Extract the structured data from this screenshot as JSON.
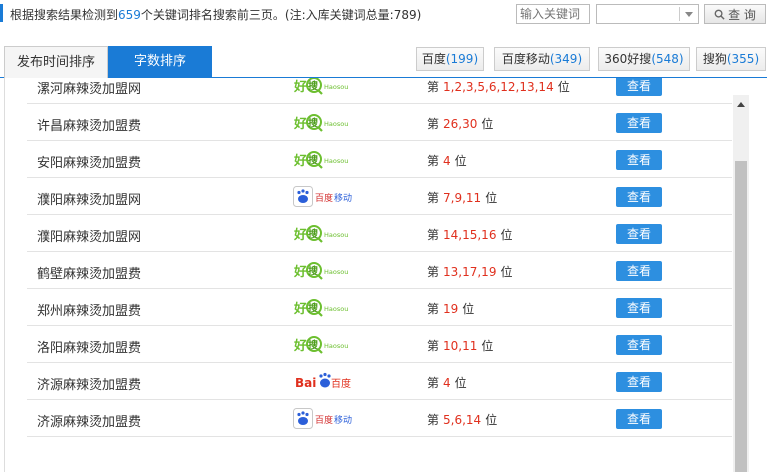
{
  "header": {
    "summary_prefix": "根据搜索结果检测到",
    "keyword_count": "659",
    "summary_suffix": "个关键词排名搜索前三页。(注:入库关键词总量:789)",
    "search_placeholder": "输入关键词",
    "select_value": "",
    "query_label": "查 询"
  },
  "tabs": [
    {
      "label": "发布时间排序",
      "active": false
    },
    {
      "label": "字数排序",
      "active": true
    }
  ],
  "engines": [
    {
      "name": "百度",
      "count": "(199)"
    },
    {
      "name": "百度移动",
      "count": "(349)"
    },
    {
      "name": "360好搜",
      "count": "(548)"
    },
    {
      "name": "搜狗",
      "count": "(355)"
    }
  ],
  "logos": {
    "haosou": {
      "main": "好搜",
      "sub": "Haosou"
    },
    "baidu_mobile": {
      "main": "百度移动"
    },
    "baidu": {
      "bai": "Bai",
      "du": "百度"
    }
  },
  "rank_prefix": "第",
  "rank_suffix": "位",
  "rows": [
    {
      "keyword": "漯河麻辣烫加盟网",
      "engine": "haosou",
      "positions": "1,2,3,5,6,12,13,14",
      "button": "查看"
    },
    {
      "keyword": "许昌麻辣烫加盟费",
      "engine": "haosou",
      "positions": "26,30",
      "button": "查看"
    },
    {
      "keyword": "安阳麻辣烫加盟费",
      "engine": "haosou",
      "positions": "4",
      "button": "查看"
    },
    {
      "keyword": "濮阳麻辣烫加盟网",
      "engine": "baidu_mobile",
      "positions": "7,9,11",
      "button": "查看"
    },
    {
      "keyword": "濮阳麻辣烫加盟网",
      "engine": "haosou",
      "positions": "14,15,16",
      "button": "查看"
    },
    {
      "keyword": "鹤壁麻辣烫加盟费",
      "engine": "haosou",
      "positions": "13,17,19",
      "button": "查看"
    },
    {
      "keyword": "郑州麻辣烫加盟费",
      "engine": "haosou",
      "positions": "19",
      "button": "查看"
    },
    {
      "keyword": "洛阳麻辣烫加盟费",
      "engine": "haosou",
      "positions": "10,11",
      "button": "查看"
    },
    {
      "keyword": "济源麻辣烫加盟费",
      "engine": "baidu",
      "positions": "4",
      "button": "查看"
    },
    {
      "keyword": "济源麻辣烫加盟费",
      "engine": "baidu_mobile",
      "positions": "5,6,14",
      "button": "查看"
    }
  ],
  "colors": {
    "accent": "#1a7bd6",
    "rank_red": "#e0301e",
    "button_blue": "#2d8fe0",
    "haosou_green": "#6cbf2f"
  }
}
